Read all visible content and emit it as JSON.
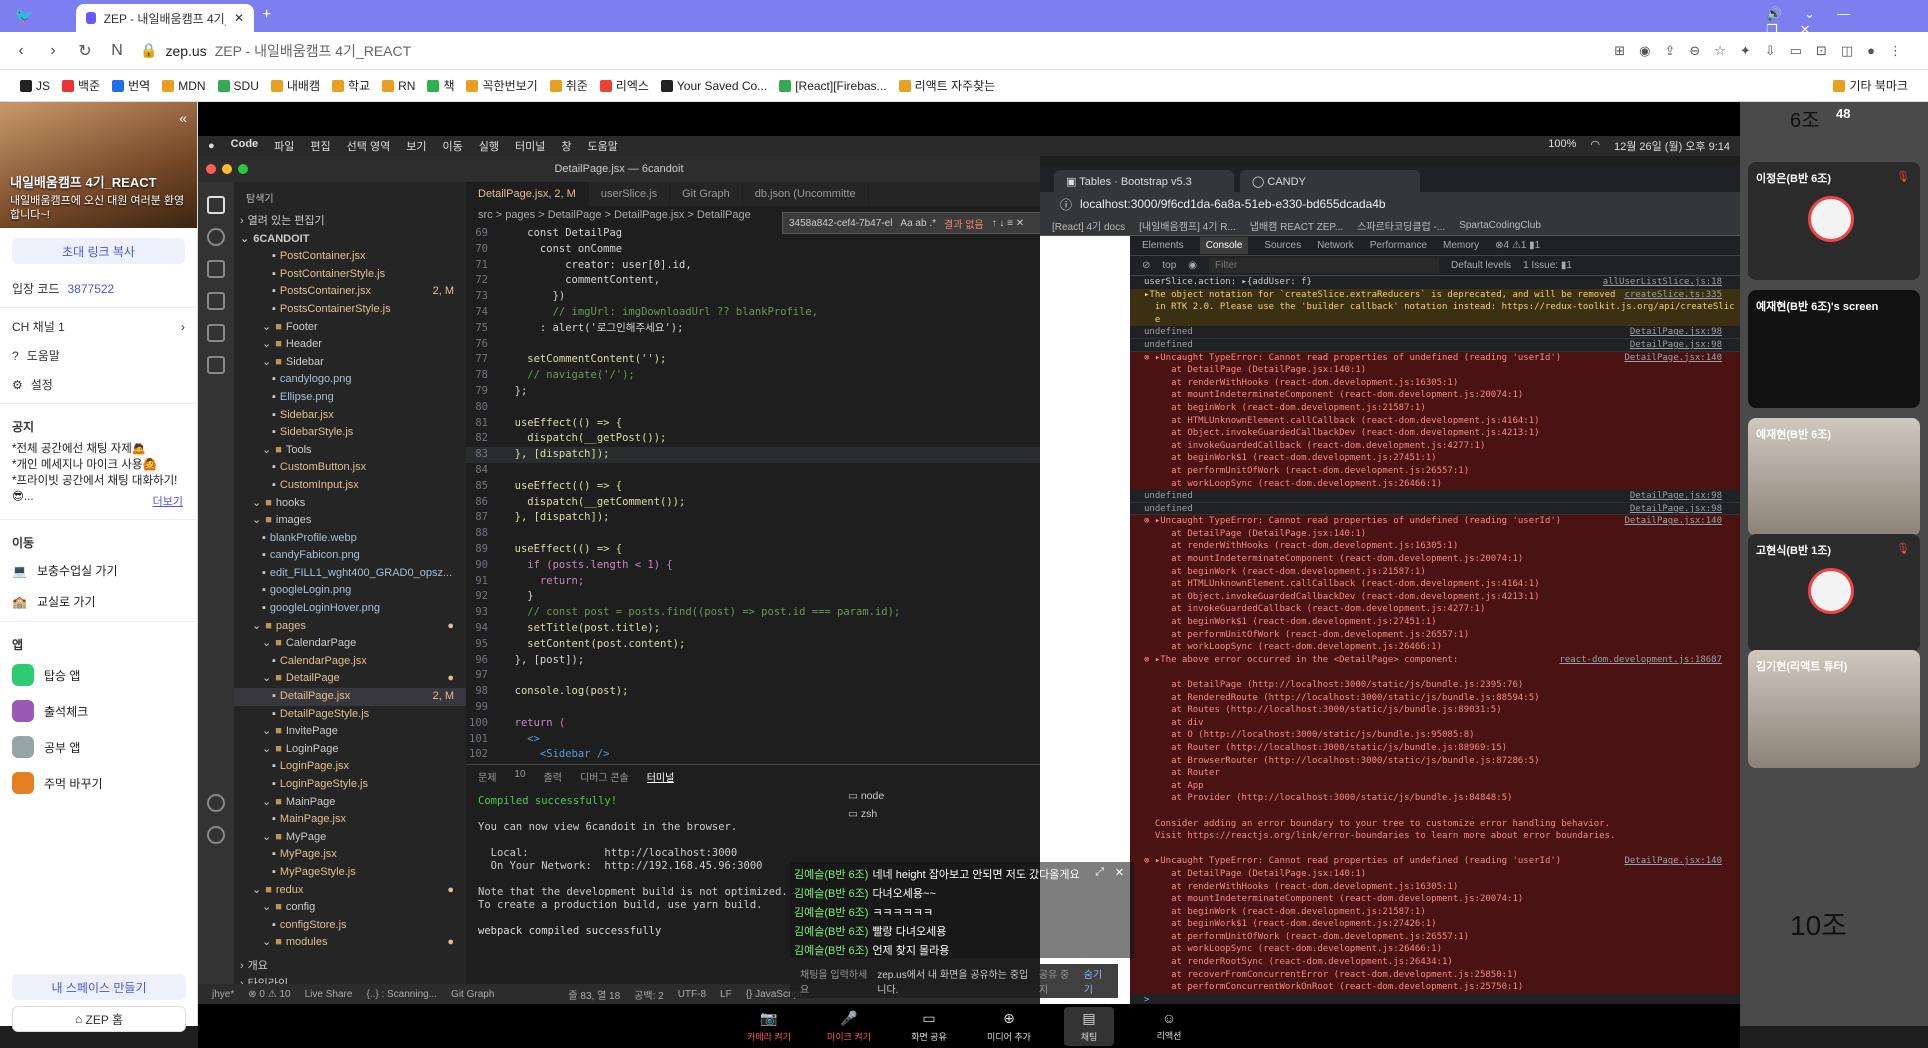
{
  "browser": {
    "tab_title": "ZEP - 내일배움캠프 4기_REA",
    "new_tab": "+",
    "url_host": "zep.us",
    "url_title": "ZEP - 내일배움캠프 4기_REACT",
    "bookmarks": [
      "JS",
      "백준",
      "번역",
      "MDN",
      "SDU",
      "내배캠",
      "학교",
      "RN",
      "책",
      "꼭한번보기",
      "취준",
      "리엑스",
      "Your Saved Co...",
      "[React][Firebas...",
      "리액트 자주찾는"
    ],
    "other_bookmarks": "기타 북마크"
  },
  "zep": {
    "space_title": "내일배움캠프 4기_REACT",
    "space_sub": "내일배움캠프에 오신 대원 여러분 환영합니다~!",
    "invite_btn": "초대 링크 복사",
    "entry_code_label": "입장 코드",
    "entry_code": "3877522",
    "channel": "CH  채널 1",
    "help": "도움말",
    "settings": "설정",
    "notice_title": "공지",
    "notices": [
      "*전체 공간에선 채팅 자제🙇",
      "*개인 메세지나 마이크 사용🙆",
      "*프라이빗 공간에서 채팅 대화하기!",
      "😎..."
    ],
    "more": "더보기",
    "move_title": "이동",
    "moves": [
      "보충수업실 가기",
      "교실로 가기"
    ],
    "apps_title": "앱",
    "apps": [
      "탑승 앱",
      "출석체크",
      "공부 앱",
      "주먹 바꾸기"
    ],
    "my_space": "내 스페이스 만들기",
    "zep_home": "ZEP 홈"
  },
  "mac": {
    "menu": [
      "Code",
      "파일",
      "편집",
      "선택 영역",
      "보기",
      "이동",
      "실행",
      "터미널",
      "창",
      "도움말"
    ],
    "battery": "100%",
    "clock": "12월 26일 (월) 오후 9:14"
  },
  "vscode": {
    "title": "DetailPage.jsx — 6candoit",
    "explorer_title": "탐색기",
    "open_editors": "열려 있는 편집기",
    "root": "6CANDOIT",
    "tabs": [
      "DetailPage.jsx, 2, M",
      "userSlice.js",
      "Git Graph",
      "db.json (Uncommitte"
    ],
    "breadcrumb": "src > pages > DetailPage > DetailPage.jsx > DetailPage",
    "find_text": "3458a842-cef4-7b47-el",
    "find_result": "결과 없음",
    "files": [
      {
        "name": "PostContainer.jsx",
        "d": 3,
        "t": "js",
        "m": ""
      },
      {
        "name": "PostContainerStyle.js",
        "d": 3,
        "t": "js",
        "m": ""
      },
      {
        "name": "PostsContainer.jsx",
        "d": 3,
        "t": "mod",
        "m": "2, M"
      },
      {
        "name": "PostsContainerStyle.js",
        "d": 3,
        "t": "js",
        "m": ""
      },
      {
        "name": "Footer",
        "d": 2,
        "t": "fold",
        "m": ""
      },
      {
        "name": "Header",
        "d": 2,
        "t": "fold",
        "m": ""
      },
      {
        "name": "Sidebar",
        "d": 2,
        "t": "fold",
        "m": ""
      },
      {
        "name": "candylogo.png",
        "d": 3,
        "t": "img",
        "m": ""
      },
      {
        "name": "Ellipse.png",
        "d": 3,
        "t": "img",
        "m": ""
      },
      {
        "name": "Sidebar.jsx",
        "d": 3,
        "t": "js",
        "m": ""
      },
      {
        "name": "SidebarStyle.js",
        "d": 3,
        "t": "js",
        "m": ""
      },
      {
        "name": "Tools",
        "d": 2,
        "t": "fold",
        "m": ""
      },
      {
        "name": "CustomButton.jsx",
        "d": 3,
        "t": "js",
        "m": ""
      },
      {
        "name": "CustomInput.jsx",
        "d": 3,
        "t": "js",
        "m": ""
      },
      {
        "name": "hooks",
        "d": 1,
        "t": "fold",
        "m": ""
      },
      {
        "name": "images",
        "d": 1,
        "t": "fold",
        "m": ""
      },
      {
        "name": "blankProfile.webp",
        "d": 2,
        "t": "img",
        "m": ""
      },
      {
        "name": "candyFabicon.png",
        "d": 2,
        "t": "img",
        "m": ""
      },
      {
        "name": "edit_FILL1_wght400_GRAD0_opsz...",
        "d": 2,
        "t": "img",
        "m": ""
      },
      {
        "name": "googleLogin.png",
        "d": 2,
        "t": "img",
        "m": ""
      },
      {
        "name": "googleLoginHover.png",
        "d": 2,
        "t": "img",
        "m": ""
      },
      {
        "name": "pages",
        "d": 1,
        "t": "mod",
        "m": "●"
      },
      {
        "name": "CalendarPage",
        "d": 2,
        "t": "fold",
        "m": ""
      },
      {
        "name": "CalendarPage.jsx",
        "d": 3,
        "t": "js",
        "m": ""
      },
      {
        "name": "DetailPage",
        "d": 2,
        "t": "mod",
        "m": "●"
      },
      {
        "name": "DetailPage.jsx",
        "d": 3,
        "t": "mod",
        "m": "2, M",
        "sel": true
      },
      {
        "name": "DetailPageStyle.js",
        "d": 3,
        "t": "js",
        "m": ""
      },
      {
        "name": "InvitePage",
        "d": 2,
        "t": "fold",
        "m": ""
      },
      {
        "name": "LoginPage",
        "d": 2,
        "t": "fold",
        "m": ""
      },
      {
        "name": "LoginPage.jsx",
        "d": 3,
        "t": "js",
        "m": ""
      },
      {
        "name": "LoginPageStyle.js",
        "d": 3,
        "t": "js",
        "m": ""
      },
      {
        "name": "MainPage",
        "d": 2,
        "t": "fold",
        "m": ""
      },
      {
        "name": "MainPage.jsx",
        "d": 3,
        "t": "js",
        "m": ""
      },
      {
        "name": "MyPage",
        "d": 2,
        "t": "fold",
        "m": ""
      },
      {
        "name": "MyPage.jsx",
        "d": 3,
        "t": "js",
        "m": ""
      },
      {
        "name": "MyPageStyle.js",
        "d": 3,
        "t": "js",
        "m": ""
      },
      {
        "name": "redux",
        "d": 1,
        "t": "mod",
        "m": "●"
      },
      {
        "name": "config",
        "d": 2,
        "t": "fold",
        "m": ""
      },
      {
        "name": "configStore.js",
        "d": 3,
        "t": "js",
        "m": ""
      },
      {
        "name": "modules",
        "d": 2,
        "t": "mod",
        "m": "●"
      }
    ],
    "outline": "개요",
    "timeline": "타임라인",
    "code": [
      [
        "",
        "    const DetailPag"
      ],
      [
        "",
        "      const onComme"
      ],
      [
        "",
        "          creator: user[0].id,"
      ],
      [
        "",
        "          commentContent,"
      ],
      [
        "",
        "        })"
      ],
      [
        "",
        "        // imgUrl: imgDownloadUrl ?? blankProfile,"
      ],
      [
        "",
        "      : alert('로그인해주세요');"
      ],
      [
        "",
        ""
      ],
      [
        "",
        "    setCommentContent('');"
      ],
      [
        "",
        "    // navigate('/');"
      ],
      [
        "",
        "  };"
      ],
      [
        "",
        ""
      ],
      [
        "",
        "  useEffect(() => {"
      ],
      [
        "",
        "    dispatch(__getPost());"
      ],
      [
        "",
        "  }, [dispatch]);"
      ],
      [
        "",
        ""
      ],
      [
        "",
        "  useEffect(() => {"
      ],
      [
        "",
        "    dispatch(__getComment());"
      ],
      [
        "",
        "  }, [dispatch]);"
      ],
      [
        "",
        ""
      ],
      [
        "",
        "  useEffect(() => {"
      ],
      [
        "",
        "    if (posts.length < 1) {"
      ],
      [
        "",
        "      return;"
      ],
      [
        "",
        "    }"
      ],
      [
        "",
        "    // const post = posts.find((post) => post.id === param.id);"
      ],
      [
        "",
        "    setTitle(post.title);"
      ],
      [
        "",
        "    setContent(post.content);"
      ],
      [
        "",
        "  }, [post]);"
      ],
      [
        "",
        ""
      ],
      [
        "",
        "  console.log(post);"
      ],
      [
        "",
        ""
      ],
      [
        "",
        "  return ("
      ],
      [
        "",
        "    <>"
      ],
      [
        "",
        "      <Sidebar />"
      ]
    ],
    "line_numbers": [
      "69",
      "70",
      "71",
      "72",
      "73",
      "74",
      "75",
      "76",
      "77",
      "78",
      "79",
      "80",
      "81",
      "82",
      "83",
      "84",
      "85",
      "86",
      "87",
      "88",
      "89",
      "90",
      "91",
      "92",
      "93",
      "94",
      "95",
      "96",
      "97",
      "98",
      "99",
      "100",
      "101",
      "102"
    ],
    "terminal_tabs": [
      "문제",
      "출력",
      "디버그 콘솔",
      "터미널"
    ],
    "problems_count": "10",
    "terminal_lines": [
      "Compiled successfully!",
      "",
      "You can now view 6candoit in the browser.",
      "",
      "  Local:            http://localhost:3000",
      "  On Your Network:  http://192.168.45.96:3000",
      "",
      "Note that the development build is not optimized.",
      "To create a production build, use yarn build.",
      "",
      "webpack compiled successfully"
    ],
    "shells": [
      "node",
      "zsh"
    ],
    "status_items": [
      "jhye*",
      "⊗ 0 ⚠ 10",
      "Live Share",
      "{..} : Scanning...",
      "Git Graph",
      "줄 83, 열 18",
      "공백: 2",
      "UTF-8",
      "LF",
      "{} JavaScript"
    ]
  },
  "chrome2": {
    "tabs": [
      "Tables · Bootstrap v5.3",
      "CANDY"
    ],
    "url": "localhost:3000/9f6cd1da-6a8a-51eb-e330-bd655dcada4b",
    "bookmarks": [
      "[React] 4기 docs",
      "[내일배움캠프] 4기 R...",
      "냅배캠 REACT ZEP...",
      "스파르타코딩클럽 -...",
      "SpartaCodingClub"
    ],
    "dev_tabs": [
      "Elements",
      "Console",
      "Sources",
      "Network",
      "Performance",
      "Memory"
    ],
    "dev_badges": "⊗4 ⚠1 ▮1",
    "dev_filter": "Filter",
    "dev_levels": "Default levels",
    "dev_issues": "1 Issue: ▮1",
    "top": "top",
    "console": [
      {
        "k": "info",
        "t": "userSlice.action: ▸{addUser: f}",
        "s": "allUserListSlice.js:18"
      },
      {
        "k": "warn",
        "t": "▸The object notation for `createSlice.extraReducers` is deprecated, and will be removed",
        "s": "createSlice.ts:335"
      },
      {
        "k": "warn",
        "t": "  in RTK 2.0. Please use the 'builder callback' notation instead: https://redux-toolkit.js.org/api/createSlic",
        "s": ""
      },
      {
        "k": "warn",
        "t": "  e",
        "s": ""
      },
      {
        "k": "undef",
        "t": "undefined",
        "s": "DetailPage.jsx:98"
      },
      {
        "k": "undef",
        "t": "undefined",
        "s": "DetailPage.jsx:98"
      },
      {
        "k": "err",
        "t": "⊗ ▸Uncaught TypeError: Cannot read properties of undefined (reading 'userId')",
        "s": "DetailPage.jsx:140"
      },
      {
        "k": "err",
        "t": "     at DetailPage (DetailPage.jsx:140:1)",
        "s": ""
      },
      {
        "k": "err",
        "t": "     at renderWithHooks (react-dom.development.js:16305:1)",
        "s": ""
      },
      {
        "k": "err",
        "t": "     at mountIndeterminateComponent (react-dom.development.js:20074:1)",
        "s": ""
      },
      {
        "k": "err",
        "t": "     at beginWork (react-dom.development.js:21587:1)",
        "s": ""
      },
      {
        "k": "err",
        "t": "     at HTMLUnknownElement.callCallback (react-dom.development.js:4164:1)",
        "s": ""
      },
      {
        "k": "err",
        "t": "     at Object.invokeGuardedCallbackDev (react-dom.development.js:4213:1)",
        "s": ""
      },
      {
        "k": "err",
        "t": "     at invokeGuardedCallback (react-dom.development.js:4277:1)",
        "s": ""
      },
      {
        "k": "err",
        "t": "     at beginWork$1 (react-dom.development.js:27451:1)",
        "s": ""
      },
      {
        "k": "err",
        "t": "     at performUnitOfWork (react-dom.development.js:26557:1)",
        "s": ""
      },
      {
        "k": "err",
        "t": "     at workLoopSync (react-dom.development.js:26466:1)",
        "s": ""
      },
      {
        "k": "undef",
        "t": "undefined",
        "s": "DetailPage.jsx:98"
      },
      {
        "k": "undef",
        "t": "undefined",
        "s": "DetailPage.jsx:98"
      },
      {
        "k": "err",
        "t": "⊗ ▸Uncaught TypeError: Cannot read properties of undefined (reading 'userId')",
        "s": "DetailPage.jsx:140"
      },
      {
        "k": "err",
        "t": "     at DetailPage (DetailPage.jsx:140:1)",
        "s": ""
      },
      {
        "k": "err",
        "t": "     at renderWithHooks (react-dom.development.js:16305:1)",
        "s": ""
      },
      {
        "k": "err",
        "t": "     at mountIndeterminateComponent (react-dom.development.js:20074:1)",
        "s": ""
      },
      {
        "k": "err",
        "t": "     at beginWork (react-dom.development.js:21587:1)",
        "s": ""
      },
      {
        "k": "err",
        "t": "     at HTMLUnknownElement.callCallback (react-dom.development.js:4164:1)",
        "s": ""
      },
      {
        "k": "err",
        "t": "     at Object.invokeGuardedCallbackDev (react-dom.development.js:4213:1)",
        "s": ""
      },
      {
        "k": "err",
        "t": "     at invokeGuardedCallback (react-dom.development.js:4277:1)",
        "s": ""
      },
      {
        "k": "err",
        "t": "     at beginWork$1 (react-dom.development.js:27451:1)",
        "s": ""
      },
      {
        "k": "err",
        "t": "     at performUnitOfWork (react-dom.development.js:26557:1)",
        "s": ""
      },
      {
        "k": "err",
        "t": "     at workLoopSync (react-dom.development.js:26466:1)",
        "s": ""
      },
      {
        "k": "err",
        "t": "⊗ ▸The above error occurred in the <DetailPage> component:",
        "s": "react-dom.development.js:18687"
      },
      {
        "k": "err",
        "t": "",
        "s": ""
      },
      {
        "k": "err",
        "t": "     at DetailPage (http://localhost:3000/static/js/bundle.js:2395:76)",
        "s": ""
      },
      {
        "k": "err",
        "t": "     at RenderedRoute (http://localhost:3000/static/js/bundle.js:88594:5)",
        "s": ""
      },
      {
        "k": "err",
        "t": "     at Routes (http://localhost:3000/static/js/bundle.js:89031:5)",
        "s": ""
      },
      {
        "k": "err",
        "t": "     at div",
        "s": ""
      },
      {
        "k": "err",
        "t": "     at O (http://localhost:3000/static/js/bundle.js:95085:8)",
        "s": ""
      },
      {
        "k": "err",
        "t": "     at Router (http://localhost:3000/static/js/bundle.js:88969:15)",
        "s": ""
      },
      {
        "k": "err",
        "t": "     at BrowserRouter (http://localhost:3000/static/js/bundle.js:87286:5)",
        "s": ""
      },
      {
        "k": "err",
        "t": "     at Router",
        "s": ""
      },
      {
        "k": "err",
        "t": "     at App",
        "s": ""
      },
      {
        "k": "err",
        "t": "     at Provider (http://localhost:3000/static/js/bundle.js:84848:5)",
        "s": ""
      },
      {
        "k": "err",
        "t": "",
        "s": ""
      },
      {
        "k": "err",
        "t": "  Consider adding an error boundary to your tree to customize error handling behavior.",
        "s": ""
      },
      {
        "k": "err",
        "t": "  Visit https://reactjs.org/link/error-boundaries to learn more about error boundaries.",
        "s": ""
      },
      {
        "k": "err",
        "t": "",
        "s": ""
      },
      {
        "k": "err",
        "t": "⊗ ▸Uncaught TypeError: Cannot read properties of undefined (reading 'userId')",
        "s": "DetailPage.jsx:140"
      },
      {
        "k": "err",
        "t": "     at DetailPage (DetailPage.jsx:140:1)",
        "s": ""
      },
      {
        "k": "err",
        "t": "     at renderWithHooks (react-dom.development.js:16305:1)",
        "s": ""
      },
      {
        "k": "err",
        "t": "     at mountIndeterminateComponent (react-dom.development.js:20074:1)",
        "s": ""
      },
      {
        "k": "err",
        "t": "     at beginWork (react-dom.development.js:21587:1)",
        "s": ""
      },
      {
        "k": "err",
        "t": "     at beginWork$1 (react-dom.development.js:27426:1)",
        "s": ""
      },
      {
        "k": "err",
        "t": "     at performUnitOfWork (react-dom.development.js:26557:1)",
        "s": ""
      },
      {
        "k": "err",
        "t": "     at workLoopSync (react-dom.development.js:26466:1)",
        "s": ""
      },
      {
        "k": "err",
        "t": "     at renderRootSync (react-dom.development.js:26434:1)",
        "s": ""
      },
      {
        "k": "err",
        "t": "     at recoverFromConcurrentError (react-dom.development.js:25850:1)",
        "s": ""
      },
      {
        "k": "err",
        "t": "     at performConcurrentWorkOnRoot (react-dom.development.js:25750:1)",
        "s": ""
      }
    ],
    "prompt": ">"
  },
  "chat": {
    "messages": [
      {
        "who": "김예슬(B반 6조)",
        "msg": "네네 height 잡아보고 안되면 저도 갔다올게요"
      },
      {
        "who": "김예슬(B반 6조)",
        "msg": "다녀오세용~~"
      },
      {
        "who": "김예슬(B반 6조)",
        "msg": "ㅋㅋㅋㅋㅋㅋ"
      },
      {
        "who": "김예슬(B반 6조)",
        "msg": "빨랑 다녀오세용"
      },
      {
        "who": "김예슬(B반 6조)",
        "msg": "언제 찾지 몰라용"
      }
    ],
    "placeholder": "채팅을 입력하세요",
    "share_notice": "zep.us에서 내 화면을 공유하는 중입니다.",
    "stop_share": "공유 중지",
    "hide": "숨기기"
  },
  "video": {
    "count": "48",
    "group_label": "6조",
    "group_label2": "10조",
    "tiles": [
      {
        "name": "이정은(B반 6조)"
      },
      {
        "name": "예재현(B반 6조)'s screen"
      },
      {
        "name": "예재현(B반 6조)"
      },
      {
        "name": "고현식(B반 1조)"
      },
      {
        "name": "김기현(리액트 튜터)"
      }
    ]
  },
  "toolbar": {
    "items": [
      "카메라 켜기",
      "마이크 켜기",
      "화면 공유",
      "미디어 추가",
      "채팅",
      "리액션"
    ]
  }
}
